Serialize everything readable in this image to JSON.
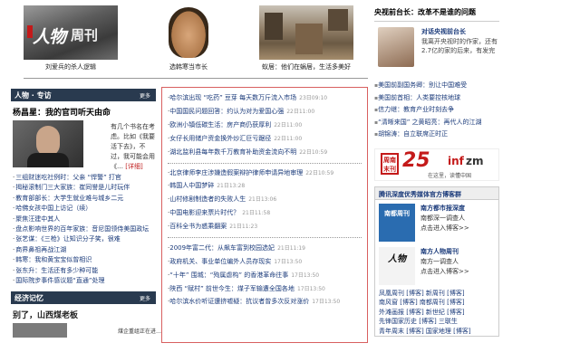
{
  "photos": [
    {
      "caption": "刘爱兵的杀人逻辑",
      "logo_main": "人物",
      "logo_sub": "周刊"
    },
    {
      "caption": "选韩寒当市长"
    },
    {
      "caption": "蚁居：他们在蜗居，生活多美好"
    }
  ],
  "left": {
    "section1_title": "人物 · 专访",
    "section1_more": "更多",
    "person_title": "杨昌星：我的官司听天由命",
    "person_desc": "有几个书名在考虑。比如《我要活下去》，不过，我可能会用《…",
    "person_detail": "[详细]",
    "links": [
      "三组财迷吃社例时：父亲 “悍警” 打官",
      "揭秘滚制门三大家族：崔同誉是儿时玩伴",
      "教育部部长：大学生就业难与城乡二元",
      "哈佛女孩中国上访记（续）",
      "聚焦汪建中其人",
      "盘点影响世界的百年家族：音尼国领侍美国政坛",
      "张艺谋：《三枪》让知识分子笑，很难",
      "商界鼻祖再战江湖",
      "韩寒：我和黄宝宝似曾相识",
      "张东升：生活还有多少种可能",
      "国际院步事件感议题“直通”处理"
    ],
    "section2_title": "经济记忆",
    "section2_more": "更多",
    "sec2_title": "别了，山西煤老板",
    "sec2_text": "煤企重组正在进…"
  },
  "news": {
    "groups": [
      [
        {
          "text": "哈尔滨出现 “吃药” 豆芽 每天数万斤流入市场",
          "time": "23日09:10"
        },
        {
          "text": "中国国民问题回答：约认为对为爱国心强",
          "time": "22日11:00"
        },
        {
          "text": "欧洲小镇低碳生活：房产商仍获厚利",
          "time": "22日11:00"
        },
        {
          "text": "女仔长用储户资金换外炒汇巨亏踞径",
          "time": "22日11:00"
        },
        {
          "text": "湖北监利县每年数千万教育补助资金流向不明",
          "time": "22日10:59"
        }
      ],
      [
        {
          "text": "北京律师李庄涉嫌造假案辩护律师申请异地审理",
          "time": "22日10:59",
          "wrap": true
        },
        {
          "text": "韩国人中国梦碎",
          "time": "21日13:28"
        },
        {
          "text": "山村修剧制造者的失败人生",
          "time": "21日13:06"
        },
        {
          "text": "中国电影迎来票片时代？",
          "time": "21日11:58"
        },
        {
          "text": "百科全书为惑乘翻案",
          "time": "21日11:23"
        }
      ],
      [
        {
          "text": "2009年富二代：从飙车富到校园选妃",
          "time": "21日11:19"
        },
        {
          "text": "政府机关、事业单位编外人员存现实",
          "time": "17日13:50"
        },
        {
          "text": "“十年” 围城：“殉属虐构” 的香港革命往事",
          "time": "17日13:50"
        },
        {
          "text": "陕西 “赋村” 前世今生：煤子军输遭全国各地",
          "time": "17日13:50"
        },
        {
          "text": "哈尔滨水价听证遭挤嘘疑：抗议者曾多次反对涨价",
          "time": "17日13:50",
          "wrap": true
        }
      ]
    ]
  },
  "right": {
    "head": "央视前台长：改革不是谁的问题",
    "feature_name": "对话央视前台长",
    "feature_text": "我离开央视时的作家，还有2.7亿的家的后来，有发完",
    "list": [
      "美国前副国务卿：别让中国难受",
      "美国前首相：人类要控核地球",
      "信力继：教育产业时刻去争",
      "“清晰来国” 之黄昭亮：再代人的江湖",
      "胡锦涛：自立联席正时正"
    ],
    "banner_seal": "周南末刊",
    "banner_num": "25",
    "banner_dom1": "inf",
    "banner_dom2": "zm",
    "banner_slogan": "在这里，读懂中国",
    "blog_head": "腾讯深度优秀媒体官方博客群",
    "blog1_logo": "南都周刊",
    "blog1_name": "南方都市报深度",
    "blog1_line1": "南都深一调查人",
    "blog1_line2": "点击进入博客>>",
    "blog2_logo": "人物",
    "blog2_name": "南方人物周刊",
    "blog2_line1": "南方一调查人",
    "blog2_line2": "点击进入博客>>",
    "bottom_lines": [
      "凤凰周刊 [博客] 新周刊 [博客]",
      "南风窗 [博客] 南都周刊 [博客]",
      "外滩画报 [博客] 新世纪 [博客]",
      "先锋国家历史 [博客] 三联生",
      "青年周末 [博客] 国家地理 [博客]"
    ]
  },
  "colors": {
    "section_bg": "#293a4f",
    "link": "#1a3a7a",
    "border_red": "#d86060",
    "accent_red": "#c41a1a"
  }
}
